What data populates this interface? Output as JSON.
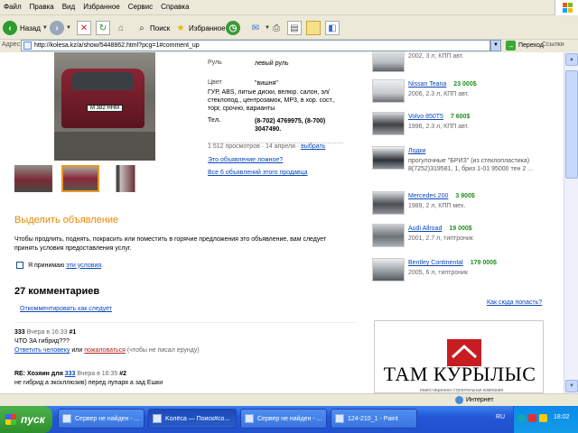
{
  "menu": {
    "items": [
      "Файл",
      "Правка",
      "Вид",
      "Избранное",
      "Сервис",
      "Справка"
    ]
  },
  "toolbar": {
    "back_label": "Назад",
    "search_label": "Поиск",
    "favorites_label": "Избранное"
  },
  "addressbar": {
    "label": "Адрес:",
    "url": "http://kolesa.kz/a/show/5448862.html?pcg=1#comment_up",
    "go_label": "Переход",
    "links_label": "Ссылки"
  },
  "listing": {
    "plate": "M 382 HHM",
    "specs": [
      {
        "label": "Руль",
        "value": "левый руль"
      },
      {
        "label": "Цвет",
        "value": "\"вишня\""
      },
      {
        "label": "",
        "value": "ГУР, ABS, литые диски, велюр. салон, эл/стеклопод., центрозамок, MP3, в хор. сост., торг, срочно, варианты"
      },
      {
        "label": "Тел.",
        "value": "(8-702) 4769975, (8-700) 3047490."
      }
    ],
    "views": "1 512 просмотров · 14 апреля · ",
    "select_link": "выбрать",
    "false_link": "Это объявление ложное?",
    "all_link": "Все 6 объявлений этого продавца"
  },
  "promo": {
    "title": "Выделить объявление",
    "text": "Чтобы продлить, поднять, покрасить или поместить в горячие предложения это объявление, вам следует принять условия предоставления услуг.",
    "agree_prefix": "Я принимаю ",
    "agree_link": "эти условия",
    "agree_suffix": "."
  },
  "comments": {
    "title": "27 комментариев",
    "button": "Откомментировать как следует",
    "items": [
      {
        "author": "333",
        "meta": "Вчера в 16:33",
        "num": "#1",
        "text": "ЧТО ЗА гибрид???",
        "reply": "Ответить человеку",
        "or": " или ",
        "complain": "пожаловаться",
        "note": " (чтобы не писал ерунду)"
      },
      {
        "prefix": "RE: Хозяин для ",
        "author": "333",
        "meta": "Вчера в 16:35",
        "num": "#2",
        "text": "не гибрид а экскллюзив) перед лупаря а зад Ешки"
      }
    ]
  },
  "sidebar": {
    "items": [
      {
        "title": "",
        "price": "",
        "desc": "2002, 3 л, КПП авт."
      },
      {
        "title": "Nissan Teana",
        "price": "23 000$",
        "desc": "2006, 2.3 л, КПП авт."
      },
      {
        "title": "Volvo 850T5",
        "price": "7 600$",
        "desc": "1996, 2.3 л, КПП авт."
      },
      {
        "title": "Лодки",
        "price": "",
        "desc": "прогулочные \"БРИЗ\" (из стеклопластика) 8(7252)319581, 1, бриз 1-01 95000 тен 2 ..."
      },
      {
        "title": "Mercedes 200",
        "price": "3 900$",
        "desc": "1989, 2 л, КПП мех."
      },
      {
        "title": "Audi Allroad",
        "price": "19 000$",
        "desc": "2001, 2.7 л, типтроник"
      },
      {
        "title": "Bentley Continental",
        "price": "179 000$",
        "desc": "2005, 6 л, типтроник"
      }
    ],
    "how_link": "Как сюда попасть?"
  },
  "banner": {
    "logo": "ТАМ КУРЫЛЫС",
    "tagline": "инвестиционно-строительная компания"
  },
  "statusbar": {
    "zone": "Интернет"
  },
  "taskbar": {
    "start": "пуск",
    "tasks": [
      "Сервер не найден - ...",
      "Kолёса — Поиск#co...",
      "Сервер не найден - ...",
      "124-210_1 - Paint"
    ],
    "lang": "RU",
    "clock": "18:02"
  },
  "colors": {
    "accent_orange": "#e58a00",
    "price_green": "#208f1e",
    "link_blue": "#0a47b8",
    "banner_red": "#c71d22"
  }
}
